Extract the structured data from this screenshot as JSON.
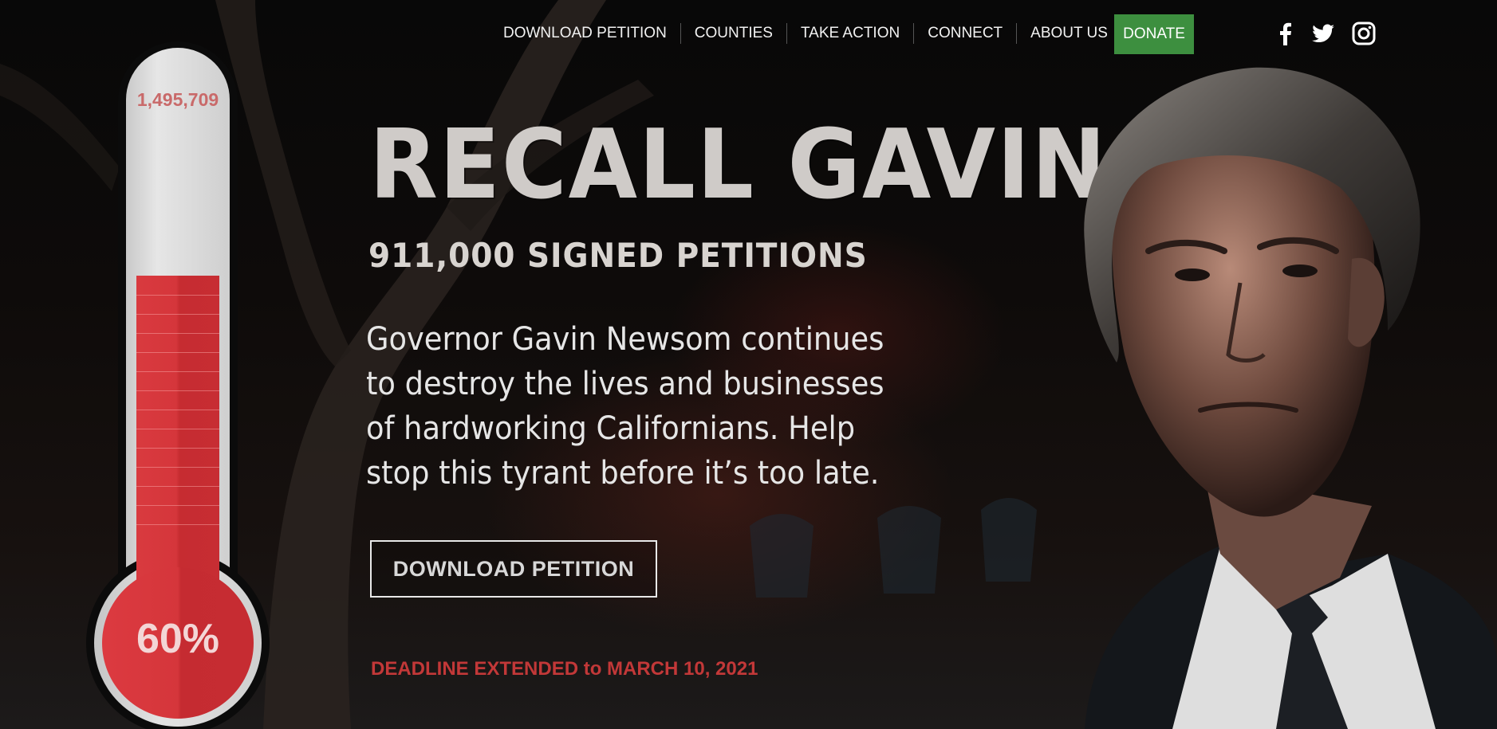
{
  "nav": {
    "links": [
      {
        "label": "DOWNLOAD PETITION"
      },
      {
        "label": "COUNTIES"
      },
      {
        "label": "TAKE ACTION"
      },
      {
        "label": "CONNECT"
      },
      {
        "label": "ABOUT US"
      }
    ],
    "donate_label": "DONATE",
    "social": [
      {
        "icon": "facebook-icon"
      },
      {
        "icon": "twitter-icon"
      },
      {
        "icon": "instagram-icon"
      }
    ]
  },
  "thermometer": {
    "goal_label": "1,495,709",
    "percent_label": "60%",
    "progress": 0.6
  },
  "hero": {
    "title": "RECALL GAVIN",
    "signed_count": "911,000 SIGNED PETITIONS",
    "body": "Governor Gavin Newsom continues to destroy the lives and businesses of hardworking Californians. Help stop this tyrant before it’s too late.",
    "cta_label": "DOWNLOAD PETITION",
    "deadline": "DEADLINE EXTENDED to MARCH 10, 2021"
  },
  "colors": {
    "donate_green": "#3d8f3f",
    "thermo_red": "#d5363b",
    "deadline_red": "#c23838",
    "goal_text": "#c96a6a"
  }
}
